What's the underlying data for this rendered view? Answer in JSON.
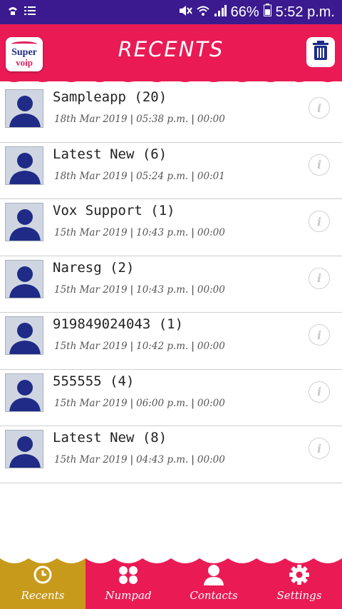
{
  "status_bar": {
    "battery_percent": "66%",
    "time": "5:52 p.m."
  },
  "header": {
    "logo_top": "Super",
    "logo_bottom": "voip",
    "title": "RECENTS"
  },
  "calls": [
    {
      "name": "Sampleapp (20)",
      "date": "18th Mar 2019",
      "time": "05:38 p.m.",
      "duration": "00:00"
    },
    {
      "name": "Latest New (6)",
      "date": "18th Mar 2019",
      "time": "05:24 p.m.",
      "duration": "00:01"
    },
    {
      "name": "Vox Support (1)",
      "date": "15th Mar 2019",
      "time": "10:43 p.m.",
      "duration": "00:00"
    },
    {
      "name": "Naresg (2)",
      "date": "15th Mar 2019",
      "time": "10:43 p.m.",
      "duration": "00:00"
    },
    {
      "name": "919849024043 (1)",
      "date": "15th Mar 2019",
      "time": "10:42 p.m.",
      "duration": "00:00"
    },
    {
      "name": "555555 (4)",
      "date": "15th Mar 2019",
      "time": "06:00 p.m.",
      "duration": "00:00"
    },
    {
      "name": "Latest New (8)",
      "date": "15th Mar 2019",
      "time": "04:43 p.m.",
      "duration": "00:00"
    }
  ],
  "info_glyph": "i",
  "nav": [
    {
      "label": "Recents",
      "icon": "clock-icon",
      "active": true
    },
    {
      "label": "Numpad",
      "icon": "numpad-icon",
      "active": false
    },
    {
      "label": "Contacts",
      "icon": "contact-icon",
      "active": false
    },
    {
      "label": "Settings",
      "icon": "gear-icon",
      "active": false
    }
  ],
  "colors": {
    "status_bar": "#3b1a8f",
    "brand": "#ea1a55",
    "active_tab": "#c89a1c",
    "avatar_bg": "#cfd6e2",
    "avatar_figure": "#1f2b86"
  }
}
